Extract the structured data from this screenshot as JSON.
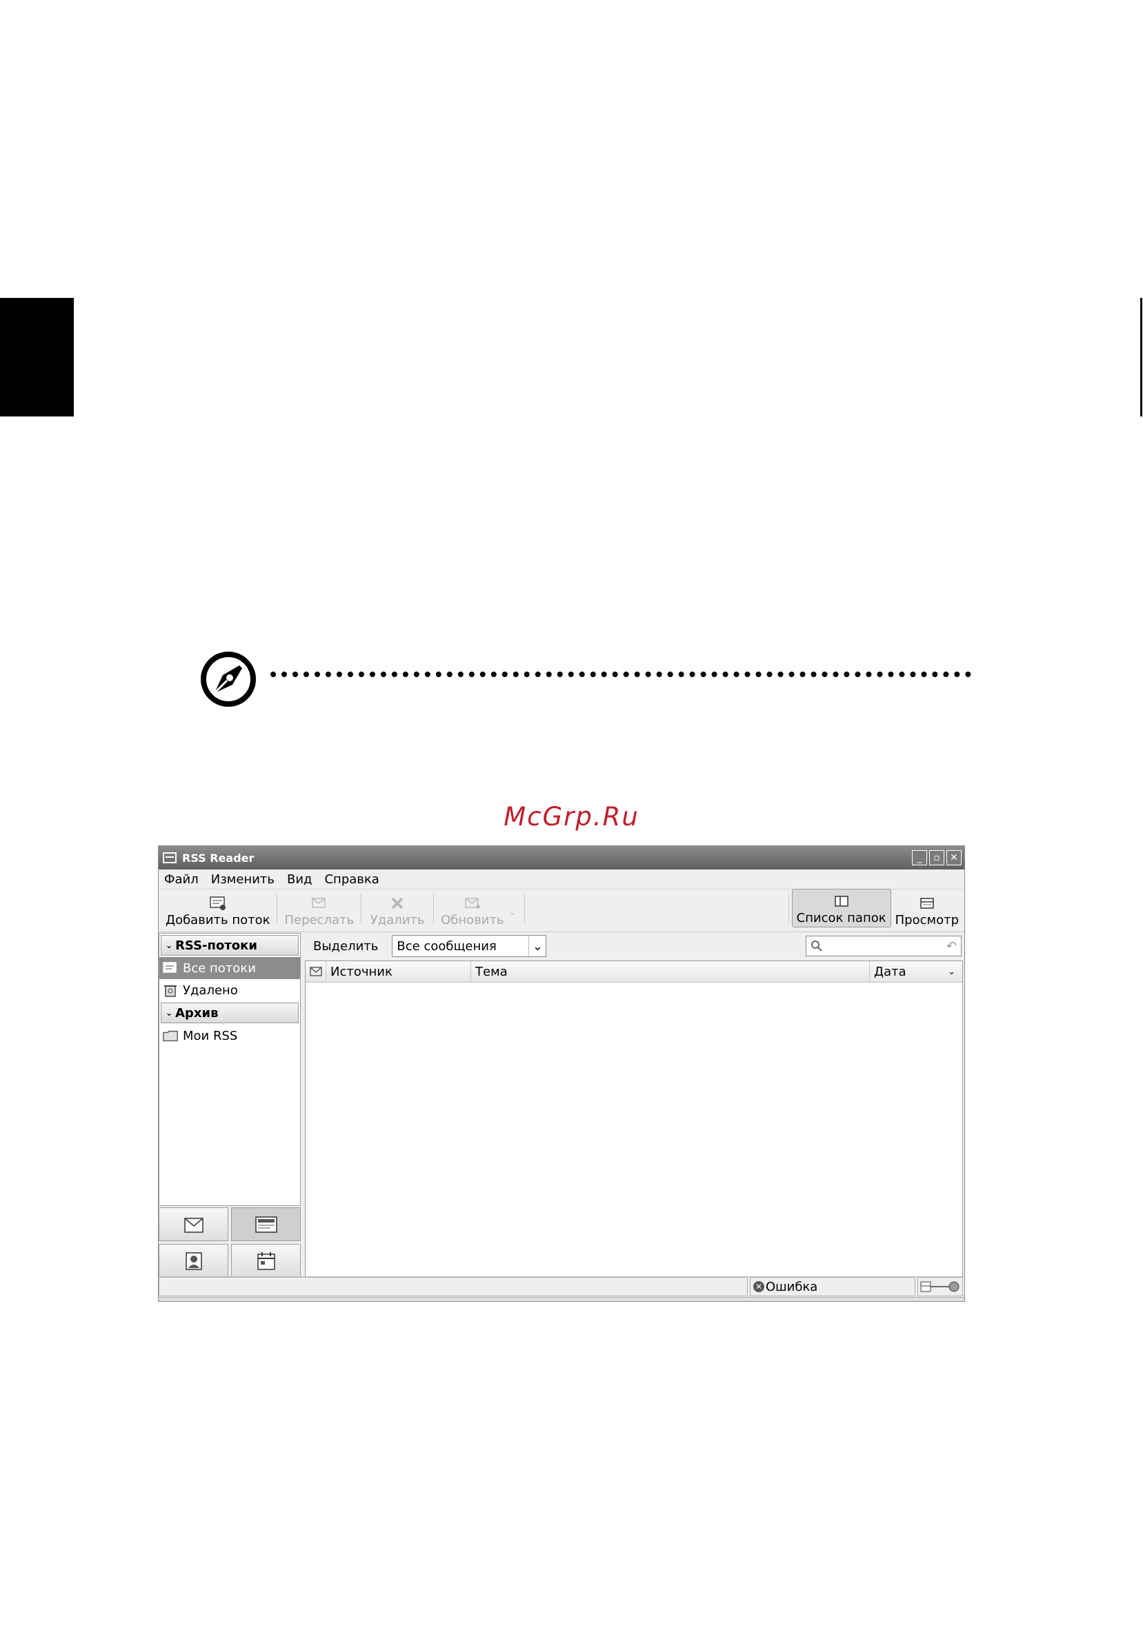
{
  "watermark": "McGrp.Ru",
  "window": {
    "title": "RSS Reader",
    "controls": {
      "minimize": "_",
      "restore": "▫",
      "close": "✕"
    }
  },
  "menu": [
    "Файл",
    "Изменить",
    "Вид",
    "Справка"
  ],
  "toolbar": {
    "add_feed": "Добавить поток",
    "forward": "Переслать",
    "delete": "Удалить",
    "update": "Обновить",
    "folder_list": "Список папок",
    "preview": "Просмотр"
  },
  "folders": {
    "rss_header": "RSS-потоки",
    "all_feeds": "Все потоки",
    "deleted": "Удалено",
    "archive_header": "Архив",
    "my_rss": "Мои RSS"
  },
  "filter": {
    "label": "Выделить",
    "selected": "Все сообщения"
  },
  "columns": {
    "source": "Источник",
    "subject": "Тема",
    "date": "Дата"
  },
  "status": {
    "error": "Ошибка"
  }
}
